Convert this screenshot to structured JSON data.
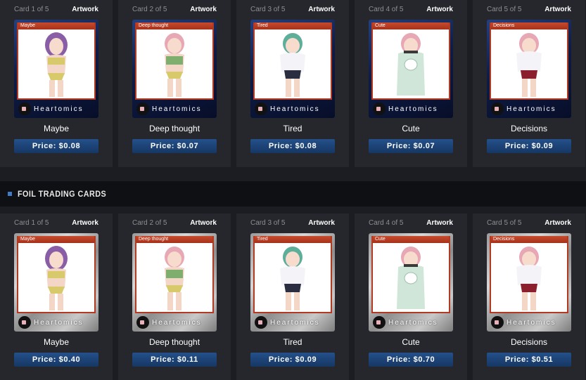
{
  "colors": {
    "page_bg": "#1b1d22",
    "panel_bg": "#25272c",
    "price_button": "#1e4a85",
    "ribbon": "#b33a22",
    "section_marker": "#3f7bc6"
  },
  "brand_text": "Heartomics",
  "artwork_label": "Artwork",
  "normal_cards": [
    {
      "count": "Card 1 of 5",
      "ribbon": "Maybe",
      "name": "Maybe",
      "price": "Price: $0.08",
      "hair": "#8a5ea6"
    },
    {
      "count": "Card 2 of 5",
      "ribbon": "Deep thought",
      "name": "Deep thought",
      "price": "Price: $0.07",
      "hair": "#e7a7b5"
    },
    {
      "count": "Card 3 of 5",
      "ribbon": "Tired",
      "name": "Tired",
      "price": "Price: $0.08",
      "hair": "#5fae9a"
    },
    {
      "count": "Card 4 of 5",
      "ribbon": "Cute",
      "name": "Cute",
      "price": "Price: $0.07",
      "hair": "#e7a7b5"
    },
    {
      "count": "Card 5 of 5",
      "ribbon": "Decisions",
      "name": "Decisions",
      "price": "Price: $0.09",
      "hair": "#e7a7b5"
    }
  ],
  "foil_section": {
    "title": "FOIL TRADING CARDS"
  },
  "foil_cards": [
    {
      "count": "Card 1 of 5",
      "ribbon": "Maybe",
      "name": "Maybe",
      "price": "Price: $0.40",
      "hair": "#8a5ea6"
    },
    {
      "count": "Card 2 of 5",
      "ribbon": "Deep thought",
      "name": "Deep thought",
      "price": "Price: $0.11",
      "hair": "#e7a7b5"
    },
    {
      "count": "Card 3 of 5",
      "ribbon": "Tired",
      "name": "Tired",
      "price": "Price: $0.09",
      "hair": "#5fae9a"
    },
    {
      "count": "Card 4 of 5",
      "ribbon": "Cute",
      "name": "Cute",
      "price": "Price: $0.70",
      "hair": "#e7a7b5"
    },
    {
      "count": "Card 5 of 5",
      "ribbon": "Decisions",
      "name": "Decisions",
      "price": "Price: $0.51",
      "hair": "#e7a7b5"
    }
  ]
}
